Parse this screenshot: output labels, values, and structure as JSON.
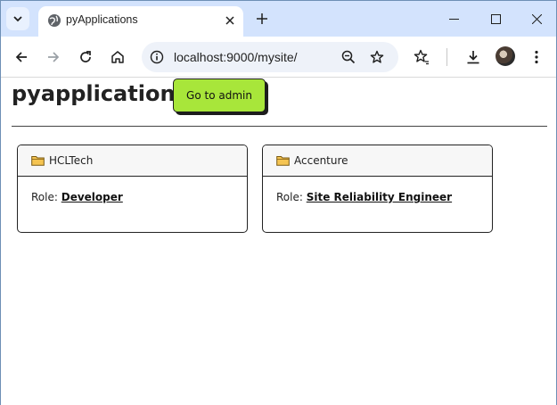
{
  "browser": {
    "tab_title": "pyApplications",
    "url": "localhost:9000/mysite/"
  },
  "page": {
    "title": "pyapplications",
    "admin_button_label": "Go to admin"
  },
  "cards": [
    {
      "company": "HCLTech",
      "role_label": "Role:",
      "role": "Developer"
    },
    {
      "company": "Accenture",
      "role_label": "Role:",
      "role": "Site Reliability Engineer"
    }
  ],
  "icons": {
    "tab_search": "chevron-down-icon",
    "favicon": "globe-icon",
    "tab_close": "close-icon",
    "new_tab": "plus-icon",
    "minimize": "minimize-icon",
    "maximize": "maximize-icon",
    "close_window": "close-icon",
    "back": "arrow-left-icon",
    "forward": "arrow-right-icon",
    "reload": "reload-icon",
    "home": "home-icon",
    "site_info": "info-icon",
    "zoom": "zoom-out-icon",
    "bookmark": "star-icon",
    "bookmarks_menu": "star-list-icon",
    "downloads": "download-icon",
    "profile": "avatar",
    "menu": "kebab-menu-icon",
    "folder": "folder-icon"
  },
  "colors": {
    "tabstrip": "#d3e3fd",
    "admin_button": "#a8e63a",
    "omnibox": "#eef2f9"
  }
}
